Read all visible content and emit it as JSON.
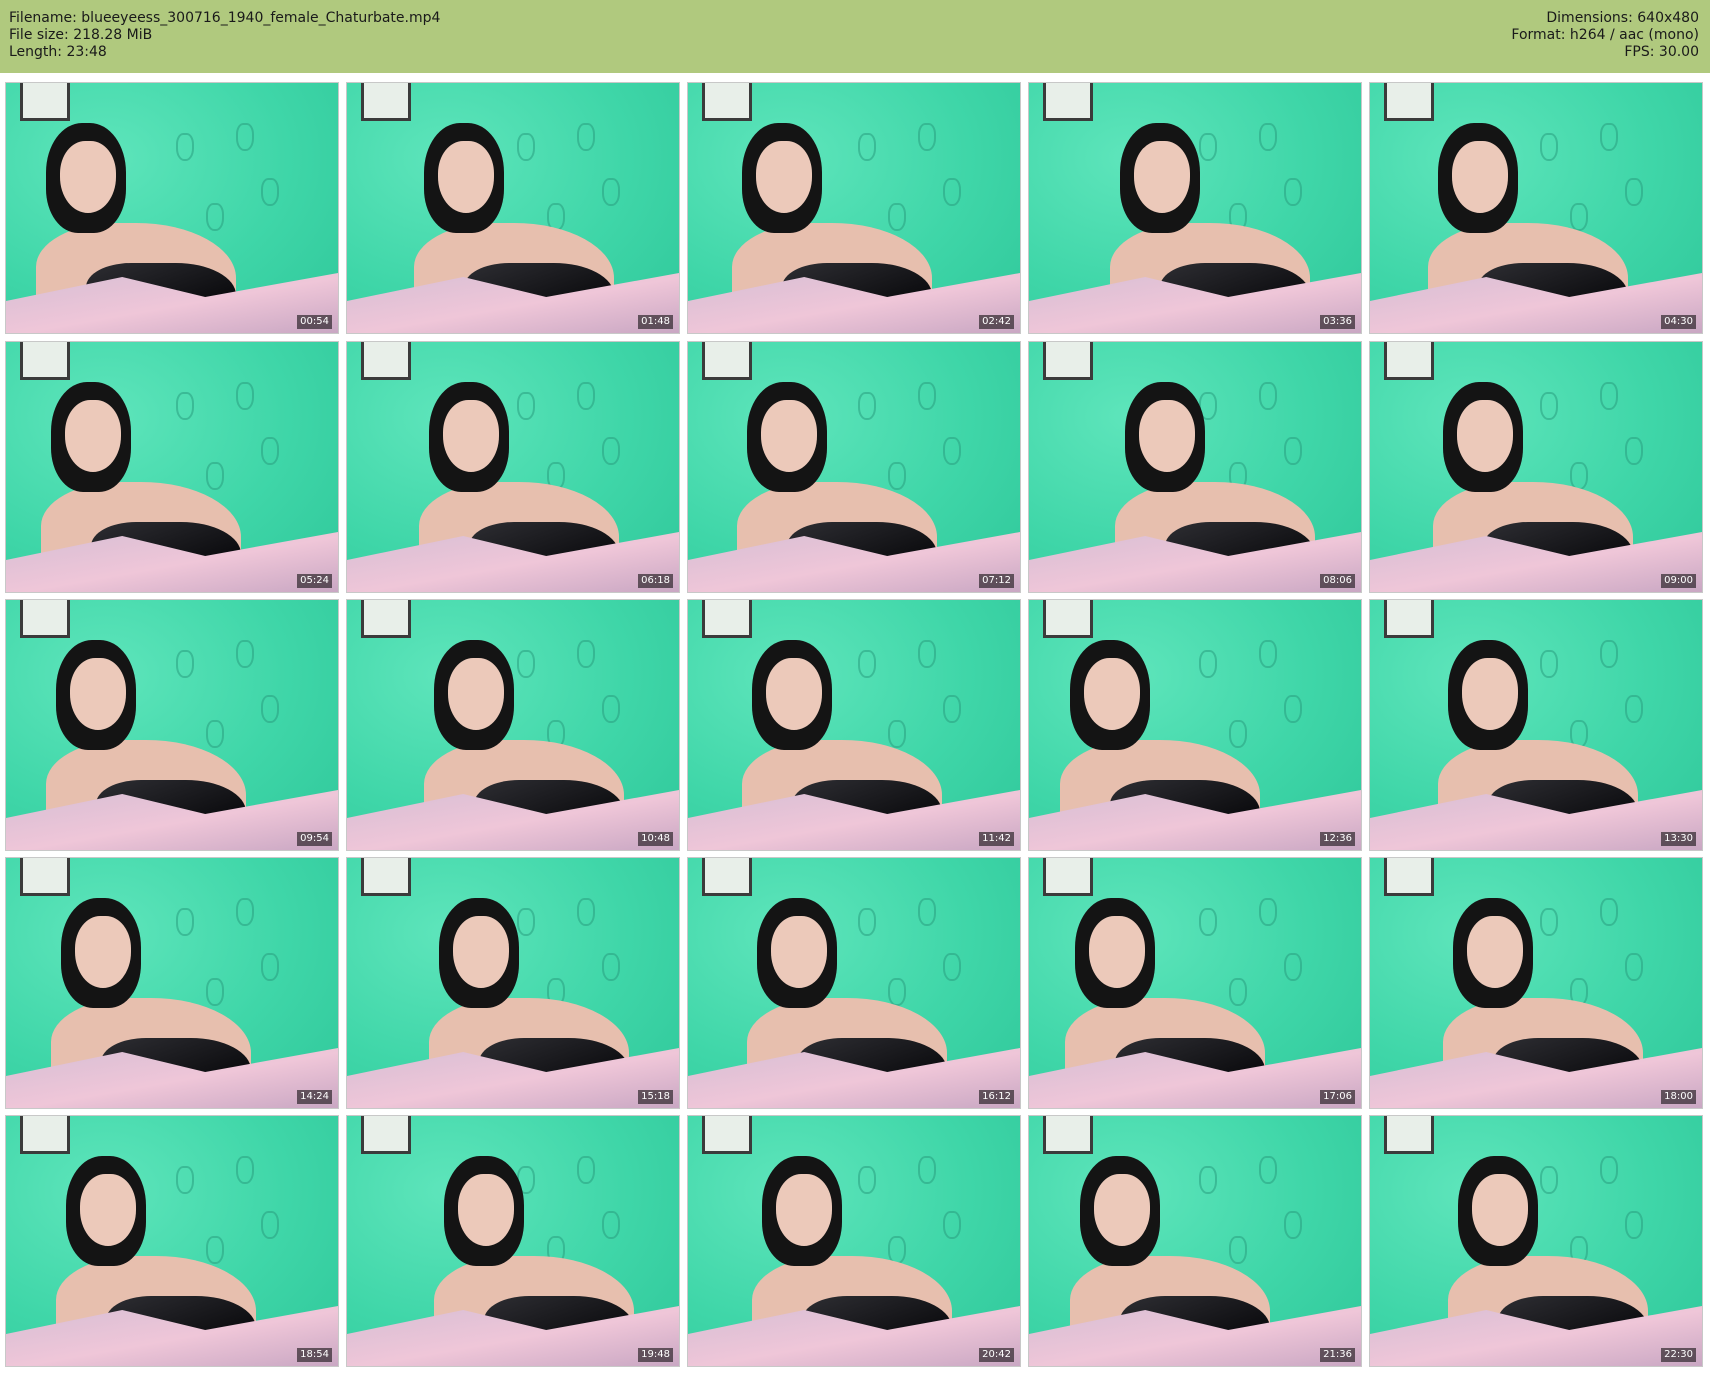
{
  "header": {
    "filename": "Filename: blueeyeess_300716_1940_female_Chaturbate.mp4",
    "filesize": "File size: 218.28 MiB",
    "length": "Length: 23:48",
    "dimensions": "Dimensions: 640x480",
    "format": "Format: h264 / aac (mono)",
    "fps": "FPS: 30.00"
  },
  "thumbnails": [
    {
      "timestamp": "00:54"
    },
    {
      "timestamp": "01:48"
    },
    {
      "timestamp": "02:42"
    },
    {
      "timestamp": "03:36"
    },
    {
      "timestamp": "04:30"
    },
    {
      "timestamp": "05:24"
    },
    {
      "timestamp": "06:18"
    },
    {
      "timestamp": "07:12"
    },
    {
      "timestamp": "08:06"
    },
    {
      "timestamp": "09:00"
    },
    {
      "timestamp": "09:54"
    },
    {
      "timestamp": "10:48"
    },
    {
      "timestamp": "11:42"
    },
    {
      "timestamp": "12:36"
    },
    {
      "timestamp": "13:30"
    },
    {
      "timestamp": "14:24"
    },
    {
      "timestamp": "15:18"
    },
    {
      "timestamp": "16:12"
    },
    {
      "timestamp": "17:06"
    },
    {
      "timestamp": "18:00"
    },
    {
      "timestamp": "18:54"
    },
    {
      "timestamp": "19:48"
    },
    {
      "timestamp": "20:42"
    },
    {
      "timestamp": "21:36"
    },
    {
      "timestamp": "22:30"
    }
  ]
}
